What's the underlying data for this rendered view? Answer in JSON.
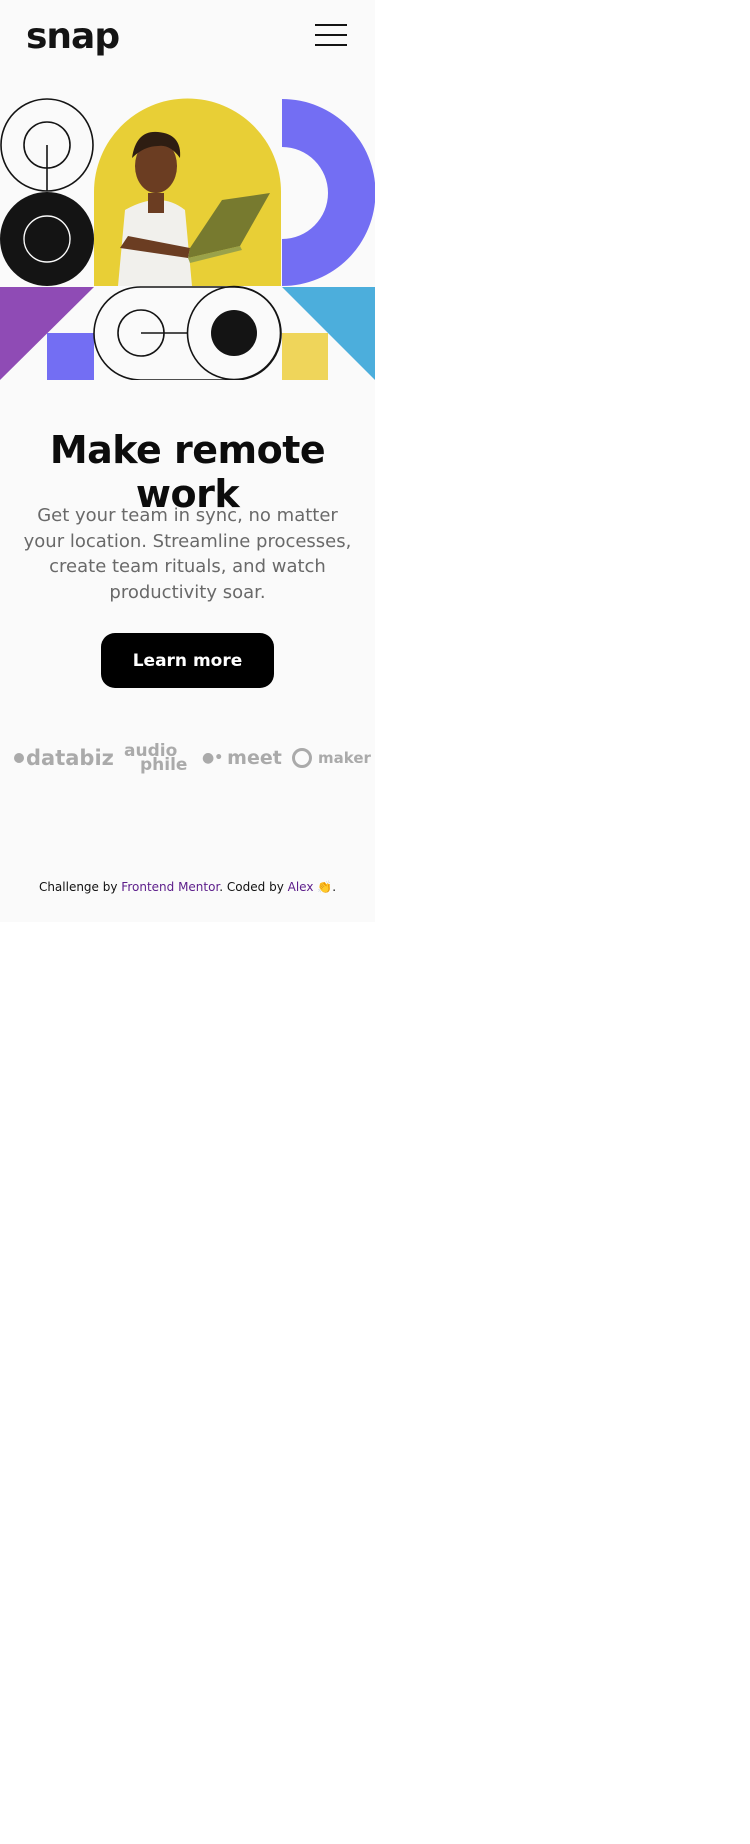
{
  "header": {
    "logo": "snap",
    "menu_icon": "hamburger-menu-icon"
  },
  "hero": {
    "image_icon": "person-with-laptop-illustration",
    "colors": {
      "yellow": "#e8cf36",
      "purple": "#736ef3",
      "violet": "#8f4bb5",
      "blue": "#4caedc",
      "mustard": "#efd55a",
      "black": "#141414"
    }
  },
  "main": {
    "headline": "Make remote work",
    "description": "Get your team in sync, no matter your location. Streamline processes, create team rituals, and watch productivity soar.",
    "cta_label": "Learn more"
  },
  "clients": {
    "databiz": "databiz",
    "audiophile_top": "audio",
    "audiophile_bottom": "phile",
    "meet": "meet",
    "maker": "maker"
  },
  "footer": {
    "prefix": "Challenge by",
    "link1": "Frontend Mentor",
    "middle": ". Coded by",
    "link2": "Alex",
    "emoji": "👏",
    "suffix": "."
  }
}
